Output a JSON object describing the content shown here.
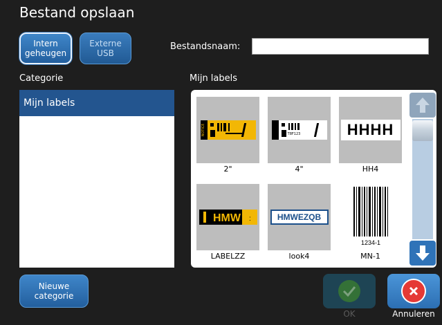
{
  "window": {
    "title": "Bestand opslaan"
  },
  "storage": {
    "internal_label_line1": "Intern",
    "internal_label_line2": "geheugen",
    "external_label_line1": "Externe",
    "external_label_line2": "USB"
  },
  "filename": {
    "label": "Bestandsnaam:",
    "value": ""
  },
  "category": {
    "heading": "Categorie",
    "items": [
      {
        "label": "Mijn labels",
        "selected": true
      }
    ],
    "new_button_line1": "Nieuwe",
    "new_button_line2": "categorie"
  },
  "labels": {
    "heading": "Mijn labels",
    "items": [
      {
        "name": "2\"",
        "preview": "notice-yellow",
        "preview_text": "NOTICE"
      },
      {
        "name": "4\"",
        "preview": "notice-white",
        "preview_text": "T8F123"
      },
      {
        "name": "HH4",
        "preview": "text",
        "preview_text": "HHHH"
      },
      {
        "name": "LABELZZ",
        "preview": "hmw-yellow",
        "preview_text": "HMW"
      },
      {
        "name": "look4",
        "preview": "hmw-box",
        "preview_text": "HMWEZQB"
      },
      {
        "name": "MN-1",
        "preview": "barcode",
        "preview_text": "1234-1"
      }
    ]
  },
  "scrollbar": {
    "up_icon": "arrow-up-icon",
    "down_icon": "arrow-down-icon",
    "position": 0.0
  },
  "actions": {
    "ok_label": "OK",
    "cancel_label": "Annuleren",
    "ok_enabled": false
  },
  "colors": {
    "accent": "#2f73b8",
    "selected": "#23558f",
    "ok": "#4caf50",
    "cancel": "#e53935"
  }
}
